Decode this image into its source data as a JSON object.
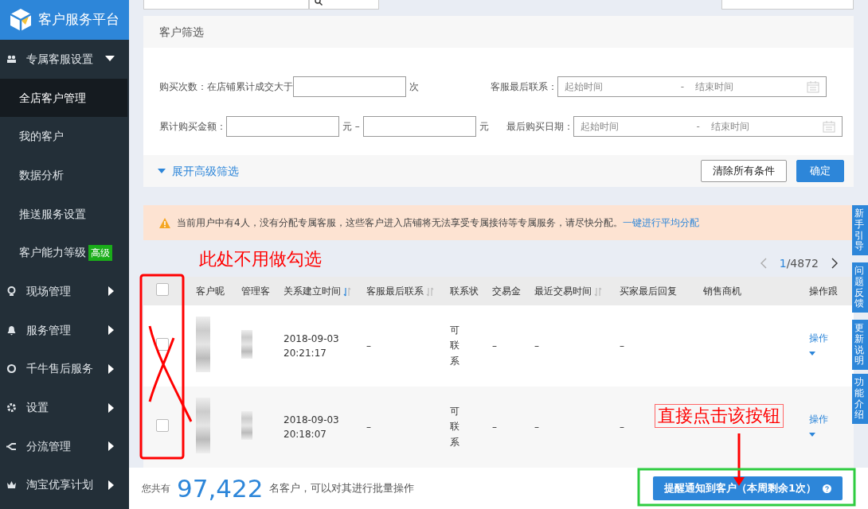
{
  "logo": {
    "title": "客户服务平台"
  },
  "sidebar": {
    "items": [
      {
        "label": "专属客服设置",
        "expanded": true,
        "children": [
          {
            "label": "全店客户管理",
            "selected": true
          },
          {
            "label": "我的客户",
            "selected": false
          },
          {
            "label": "数据分析",
            "selected": false
          },
          {
            "label": "推送服务设置",
            "selected": false
          },
          {
            "label": "客户能力等级",
            "selected": false,
            "badge": "高级"
          }
        ]
      },
      {
        "label": "现场管理",
        "expanded": false
      },
      {
        "label": "服务管理",
        "expanded": false
      },
      {
        "label": "千牛售后服务",
        "expanded": false
      },
      {
        "label": "设置",
        "expanded": false
      },
      {
        "label": "分流管理",
        "expanded": false
      },
      {
        "label": "淘宝优享计划",
        "expanded": false
      }
    ]
  },
  "filter": {
    "title": "客户筛选",
    "purchase_count": {
      "label": "购买次数：在店铺累计成交大于",
      "unit": "次"
    },
    "amount": {
      "label": "累计购买金额：",
      "unit_from": "元 –",
      "unit_to": "元"
    },
    "date_ranges": [
      {
        "label": "客服最后联系：",
        "start_placeholder": "起始时间",
        "separator": "-",
        "end_placeholder": "结束时间"
      },
      {
        "label": "最后购买日期：",
        "start_placeholder": "起始时间",
        "separator": "-",
        "end_placeholder": "结束时间"
      }
    ],
    "advanced_toggle": "展开高级筛选",
    "buttons": [
      {
        "label": "清除所有条件",
        "kind": "secondary"
      },
      {
        "label": "确定",
        "kind": "primary"
      }
    ]
  },
  "alert": {
    "message": "当前用户中有4人，没有分配专属客服，这些客户进入店铺将无法享受专属接待等专属服务，请尽快分配。",
    "link": "一键进行平均分配"
  },
  "pagination": {
    "current": "1",
    "total": "/4872"
  },
  "table": {
    "select_all_checked": false,
    "columns": [
      {
        "label": "客户昵",
        "sortable": false
      },
      {
        "label": "管理客",
        "sortable": false
      },
      {
        "label": "关系建立时间",
        "sortable": true
      },
      {
        "label": "客服最后联系",
        "sortable": true
      },
      {
        "label": "联系状",
        "sortable": false
      },
      {
        "label": "交易金",
        "sortable": false
      },
      {
        "label": "最近交易时间",
        "sortable": true
      },
      {
        "label": "买家最后回复",
        "sortable": false
      },
      {
        "label": "销售商机",
        "sortable": false
      },
      {
        "label": "操作跟",
        "sortable": false
      }
    ],
    "rows": [
      {
        "checked": false,
        "created": "2018-09-03 20:21:17",
        "last_contact": "–",
        "status": "可联系",
        "amount": "–",
        "last_trade": "–",
        "last_reply": "–",
        "action": "操作"
      },
      {
        "checked": false,
        "created": "2018-09-03 20:18:07",
        "last_contact": "–",
        "status": "可联系",
        "amount": "–",
        "last_trade": "–",
        "last_reply": "–",
        "action": "操作"
      }
    ]
  },
  "footer": {
    "prefix": "您共有",
    "count": "97,422",
    "suffix": "名客户，可以对其进行批量操作",
    "button": "提醒通知到客户（本周剩余1次）"
  },
  "side_tabs": [
    "新手引导",
    "问题反馈",
    "更新说明",
    "功能介绍"
  ],
  "annotations": {
    "checkbox_note": "此处不用做勾选",
    "button_note": "直接点击该按钮"
  }
}
